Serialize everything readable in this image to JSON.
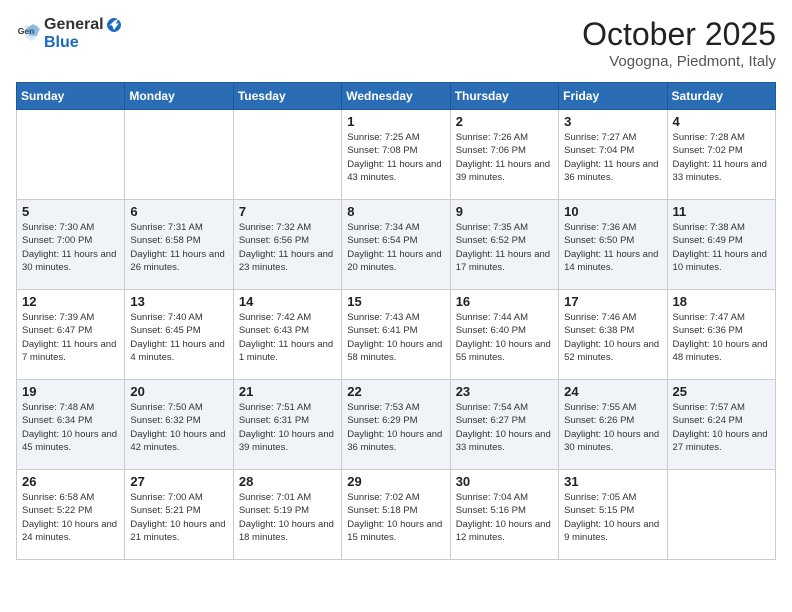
{
  "header": {
    "logo_general": "General",
    "logo_blue": "Blue",
    "month": "October 2025",
    "location": "Vogogna, Piedmont, Italy"
  },
  "weekdays": [
    "Sunday",
    "Monday",
    "Tuesday",
    "Wednesday",
    "Thursday",
    "Friday",
    "Saturday"
  ],
  "weeks": [
    [
      {
        "day": "",
        "info": ""
      },
      {
        "day": "",
        "info": ""
      },
      {
        "day": "",
        "info": ""
      },
      {
        "day": "1",
        "info": "Sunrise: 7:25 AM\nSunset: 7:08 PM\nDaylight: 11 hours and 43 minutes."
      },
      {
        "day": "2",
        "info": "Sunrise: 7:26 AM\nSunset: 7:06 PM\nDaylight: 11 hours and 39 minutes."
      },
      {
        "day": "3",
        "info": "Sunrise: 7:27 AM\nSunset: 7:04 PM\nDaylight: 11 hours and 36 minutes."
      },
      {
        "day": "4",
        "info": "Sunrise: 7:28 AM\nSunset: 7:02 PM\nDaylight: 11 hours and 33 minutes."
      }
    ],
    [
      {
        "day": "5",
        "info": "Sunrise: 7:30 AM\nSunset: 7:00 PM\nDaylight: 11 hours and 30 minutes."
      },
      {
        "day": "6",
        "info": "Sunrise: 7:31 AM\nSunset: 6:58 PM\nDaylight: 11 hours and 26 minutes."
      },
      {
        "day": "7",
        "info": "Sunrise: 7:32 AM\nSunset: 6:56 PM\nDaylight: 11 hours and 23 minutes."
      },
      {
        "day": "8",
        "info": "Sunrise: 7:34 AM\nSunset: 6:54 PM\nDaylight: 11 hours and 20 minutes."
      },
      {
        "day": "9",
        "info": "Sunrise: 7:35 AM\nSunset: 6:52 PM\nDaylight: 11 hours and 17 minutes."
      },
      {
        "day": "10",
        "info": "Sunrise: 7:36 AM\nSunset: 6:50 PM\nDaylight: 11 hours and 14 minutes."
      },
      {
        "day": "11",
        "info": "Sunrise: 7:38 AM\nSunset: 6:49 PM\nDaylight: 11 hours and 10 minutes."
      }
    ],
    [
      {
        "day": "12",
        "info": "Sunrise: 7:39 AM\nSunset: 6:47 PM\nDaylight: 11 hours and 7 minutes."
      },
      {
        "day": "13",
        "info": "Sunrise: 7:40 AM\nSunset: 6:45 PM\nDaylight: 11 hours and 4 minutes."
      },
      {
        "day": "14",
        "info": "Sunrise: 7:42 AM\nSunset: 6:43 PM\nDaylight: 11 hours and 1 minute."
      },
      {
        "day": "15",
        "info": "Sunrise: 7:43 AM\nSunset: 6:41 PM\nDaylight: 10 hours and 58 minutes."
      },
      {
        "day": "16",
        "info": "Sunrise: 7:44 AM\nSunset: 6:40 PM\nDaylight: 10 hours and 55 minutes."
      },
      {
        "day": "17",
        "info": "Sunrise: 7:46 AM\nSunset: 6:38 PM\nDaylight: 10 hours and 52 minutes."
      },
      {
        "day": "18",
        "info": "Sunrise: 7:47 AM\nSunset: 6:36 PM\nDaylight: 10 hours and 48 minutes."
      }
    ],
    [
      {
        "day": "19",
        "info": "Sunrise: 7:48 AM\nSunset: 6:34 PM\nDaylight: 10 hours and 45 minutes."
      },
      {
        "day": "20",
        "info": "Sunrise: 7:50 AM\nSunset: 6:32 PM\nDaylight: 10 hours and 42 minutes."
      },
      {
        "day": "21",
        "info": "Sunrise: 7:51 AM\nSunset: 6:31 PM\nDaylight: 10 hours and 39 minutes."
      },
      {
        "day": "22",
        "info": "Sunrise: 7:53 AM\nSunset: 6:29 PM\nDaylight: 10 hours and 36 minutes."
      },
      {
        "day": "23",
        "info": "Sunrise: 7:54 AM\nSunset: 6:27 PM\nDaylight: 10 hours and 33 minutes."
      },
      {
        "day": "24",
        "info": "Sunrise: 7:55 AM\nSunset: 6:26 PM\nDaylight: 10 hours and 30 minutes."
      },
      {
        "day": "25",
        "info": "Sunrise: 7:57 AM\nSunset: 6:24 PM\nDaylight: 10 hours and 27 minutes."
      }
    ],
    [
      {
        "day": "26",
        "info": "Sunrise: 6:58 AM\nSunset: 5:22 PM\nDaylight: 10 hours and 24 minutes."
      },
      {
        "day": "27",
        "info": "Sunrise: 7:00 AM\nSunset: 5:21 PM\nDaylight: 10 hours and 21 minutes."
      },
      {
        "day": "28",
        "info": "Sunrise: 7:01 AM\nSunset: 5:19 PM\nDaylight: 10 hours and 18 minutes."
      },
      {
        "day": "29",
        "info": "Sunrise: 7:02 AM\nSunset: 5:18 PM\nDaylight: 10 hours and 15 minutes."
      },
      {
        "day": "30",
        "info": "Sunrise: 7:04 AM\nSunset: 5:16 PM\nDaylight: 10 hours and 12 minutes."
      },
      {
        "day": "31",
        "info": "Sunrise: 7:05 AM\nSunset: 5:15 PM\nDaylight: 10 hours and 9 minutes."
      },
      {
        "day": "",
        "info": ""
      }
    ]
  ]
}
